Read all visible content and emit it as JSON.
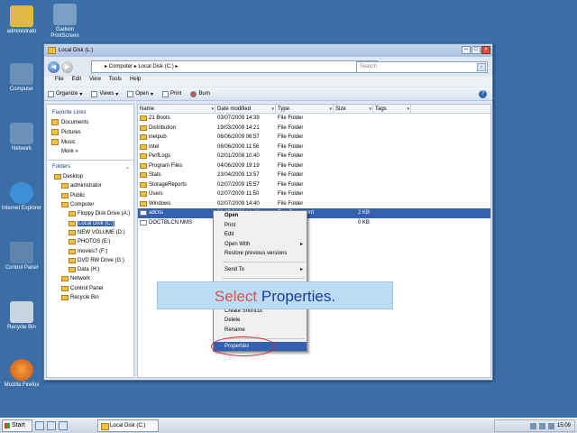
{
  "desktop_icons": [
    {
      "label": "administrato"
    },
    {
      "label": "Gadwin PrintScreen"
    },
    {
      "label": "Computer"
    },
    {
      "label": "Network"
    },
    {
      "label": "Internet Explorer"
    },
    {
      "label": "Control Panel"
    },
    {
      "label": "Recycle Bin"
    },
    {
      "label": "Mozilla Firefox"
    }
  ],
  "window": {
    "title": "Local Disk (L:)",
    "address": "▸ Computer ▸ Local Disk (C:) ▸",
    "search_placeholder": "Search",
    "menu": [
      "File",
      "Edit",
      "View",
      "Tools",
      "Help"
    ],
    "toolbar": [
      "Organize",
      "Views",
      "Open",
      "Print",
      "Burn"
    ]
  },
  "navpane": {
    "favorites_title": "Favorite Links",
    "favorites": [
      "Documents",
      "Pictures",
      "Music"
    ],
    "more_label": "More »",
    "folders_label": "Folders",
    "tree": [
      {
        "label": "Desktop",
        "indent": 1
      },
      {
        "label": "administrator",
        "indent": 2
      },
      {
        "label": "Public",
        "indent": 2
      },
      {
        "label": "Computer",
        "indent": 2
      },
      {
        "label": "Floppy Disk Drive (A:)",
        "indent": 3
      },
      {
        "label": "Local Disk (C:)",
        "indent": 3,
        "selected": true
      },
      {
        "label": "NEW VOLUME (D:)",
        "indent": 3
      },
      {
        "label": "PHOTOS (E:)",
        "indent": 3
      },
      {
        "label": "movies? (F:)",
        "indent": 3
      },
      {
        "label": "DVD RW Drive (G:)",
        "indent": 3
      },
      {
        "label": "Data (H:)",
        "indent": 3
      },
      {
        "label": "Network",
        "indent": 2
      },
      {
        "label": "Control Panel",
        "indent": 2
      },
      {
        "label": "Recycle Bin",
        "indent": 2
      }
    ]
  },
  "files": {
    "columns": [
      "Name",
      "Date modified",
      "Type",
      "Size",
      "Tags"
    ],
    "rows": [
      {
        "name": "21 Boots",
        "date": "03/07/2009 14:39",
        "type": "File Folder",
        "size": "",
        "kind": "folder"
      },
      {
        "name": "Distribution",
        "date": "19/03/2009 14:21",
        "type": "File Folder",
        "size": "",
        "kind": "folder"
      },
      {
        "name": "inetpub",
        "date": "06/06/2009 06:57",
        "type": "File Folder",
        "size": "",
        "kind": "folder"
      },
      {
        "name": "Intel",
        "date": "06/06/2009 11:56",
        "type": "File Folder",
        "size": "",
        "kind": "folder"
      },
      {
        "name": "PerfLogs",
        "date": "02/01/2008 10:40",
        "type": "File Folder",
        "size": "",
        "kind": "folder"
      },
      {
        "name": "Program Files",
        "date": "04/06/2009 19:19",
        "type": "File Folder",
        "size": "",
        "kind": "folder"
      },
      {
        "name": "Stats",
        "date": "23/04/2009 13:57",
        "type": "File Folder",
        "size": "",
        "kind": "folder"
      },
      {
        "name": "StorageReports",
        "date": "02/07/2009 15:57",
        "type": "File Folder",
        "size": "",
        "kind": "folder"
      },
      {
        "name": "Users",
        "date": "02/07/2009 11:50",
        "type": "File Folder",
        "size": "",
        "kind": "folder"
      },
      {
        "name": "Windows",
        "date": "02/07/2009 14:40",
        "type": "File Folder",
        "size": "",
        "kind": "folder"
      },
      {
        "name": "adcns",
        "date": "03/07/2009 14:40",
        "type": "Text Document",
        "size": "2 KB",
        "kind": "file",
        "selected": true
      },
      {
        "name": "DOCTBLCN.NMS",
        "date": "",
        "type": "",
        "size": "0 KB",
        "kind": "file"
      }
    ]
  },
  "context_menu": [
    {
      "label": "Open",
      "bold": true
    },
    {
      "label": "Print"
    },
    {
      "label": "Edit"
    },
    {
      "label": "Open With",
      "submenu": true
    },
    {
      "label": "Restore previous versions"
    },
    {
      "sep": true
    },
    {
      "label": "Send To",
      "submenu": true
    },
    {
      "sep": true
    },
    {
      "label": "Cut"
    },
    {
      "label": "Copy"
    },
    {
      "sep": true
    },
    {
      "label": "Create Shortcut"
    },
    {
      "label": "Delete"
    },
    {
      "label": "Rename"
    },
    {
      "sep": true
    },
    {
      "label": "Properties",
      "highlighted": true
    }
  ],
  "callout": {
    "word1": "Select",
    "word2": "Properties."
  },
  "taskbar": {
    "start_label": "Start",
    "task_label": "Local Disk (C:)",
    "clock": "15:09"
  },
  "colors": {
    "desktop": "#3a6ea5",
    "selection": "#3360b0",
    "callout_bg": "#bcdcf4",
    "highlight_ring": "#d0202a"
  }
}
